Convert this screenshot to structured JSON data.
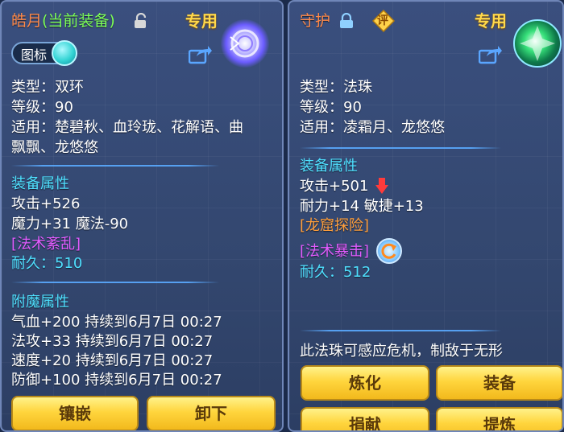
{
  "left": {
    "title_name": "皓月",
    "title_status": "(当前装备)",
    "exclusive": "专用",
    "icon_toggle_label": "图标",
    "lines": {
      "type": "类型：双环",
      "level": "等级：90",
      "suitable_1": "适用：楚碧秋、血玲珑、花解语、曲",
      "suitable_2": "飘飘、龙悠悠"
    },
    "equip_attr_title": "装备属性",
    "attack": "攻击+526",
    "magic": "魔力+31 魔法-90",
    "special": "[法术紊乱]",
    "durability_label": "耐久：",
    "durability_value": "510",
    "enchant_title": "附魔属性",
    "enchant": [
      "气血+200 持续到6月7日 00:27",
      "法攻+33 持续到6月7日 00:27",
      "速度+20 持续到6月7日 00:27",
      "防御+100 持续到6月7日 00:27"
    ],
    "buttons": {
      "inlay": "镶嵌",
      "unload": "卸下"
    },
    "icons": {
      "lock": "unlock-icon",
      "share": "share-icon",
      "item": "ring-weapon-icon"
    }
  },
  "right": {
    "title_name": "守护",
    "exclusive": "专用",
    "review_badge": "评",
    "lines": {
      "type": "类型：法珠",
      "level": "等级：90",
      "suitable": "适用：凌霜月、龙悠悠"
    },
    "equip_attr_title": "装备属性",
    "attack": "攻击+501",
    "stats": "耐力+14 敏捷+13",
    "dungeon": "[龙窟探险]",
    "special": "[法术暴击]",
    "durability_label": "耐久：",
    "durability_value": "512",
    "description": "此法珠可感应危机，制敌于无形",
    "buttons": {
      "refine": "炼化",
      "equip": "装备",
      "donate": "捐献",
      "extract": "提炼"
    },
    "icons": {
      "lock": "lock-icon",
      "share": "share-icon",
      "item": "orb-icon",
      "down_arrow": "arrow-down-icon",
      "refresh": "refresh-icon"
    }
  },
  "colors": {
    "title_name": "#ff8a4a",
    "current_equip": "#7dff57",
    "attr_title": "#4fe0ff",
    "durability": "#4fe0ff",
    "special_purple": "#e25cff",
    "dungeon_orange": "#ff9f3d",
    "button_gold": "#ffd53d"
  }
}
